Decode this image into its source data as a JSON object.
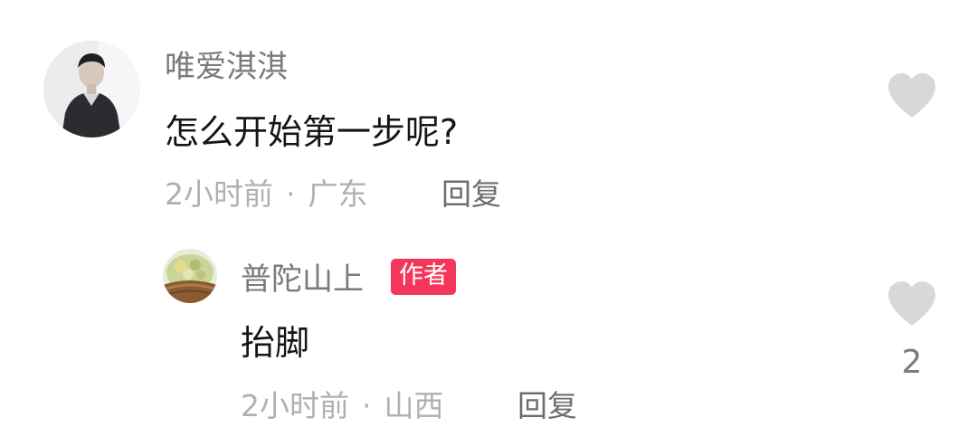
{
  "comment": {
    "username": "唯爱淇淇",
    "text": "怎么开始第一步呢?",
    "time": "2小时前",
    "separator": "·",
    "location": "广东",
    "reply_label": "回复",
    "like_icon": "heart-icon"
  },
  "reply": {
    "username": "普陀山上",
    "badge": "作者",
    "text": "抬脚",
    "time": "2小时前",
    "separator": "·",
    "location": "山西",
    "reply_label": "回复",
    "like_icon": "heart-icon",
    "like_count": "2"
  },
  "colors": {
    "badge": "#f4365a",
    "heart": "#d8d8d8",
    "username": "#7a7a7a",
    "meta": "#b0b0b0"
  }
}
